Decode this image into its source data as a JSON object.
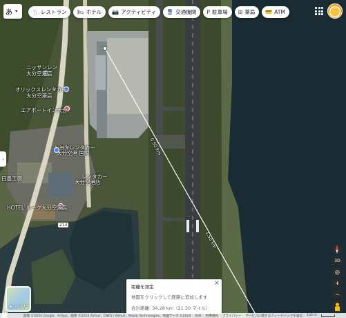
{
  "top_bar": {
    "lang_label": "あ",
    "chips": [
      {
        "icon": "fork-knife-icon",
        "glyph": "🍴",
        "label": "レストラン"
      },
      {
        "icon": "bed-icon",
        "glyph": "🛏",
        "label": "ホテル"
      },
      {
        "icon": "camera-icon",
        "glyph": "📷",
        "label": "アクティビティ"
      },
      {
        "icon": "train-icon",
        "glyph": "🚆",
        "label": "交通機関"
      },
      {
        "icon": "parking-icon",
        "glyph": "P",
        "label": "駐車場"
      },
      {
        "icon": "pharmacy-icon",
        "glyph": "⊞",
        "label": "薬局"
      },
      {
        "icon": "atm-icon",
        "glyph": "💳",
        "label": "ATM"
      }
    ]
  },
  "map_labels": {
    "nissan": "ニッサンレン",
    "nissan_sub": "大分空港店",
    "orix": "オリックスレンタカー",
    "orix_sub": "大分空港店",
    "airport_inn": "エアポートイン大分",
    "toyota": "トヨタレンタカー",
    "toyota_sub": "大分空港 国際",
    "rentacar_small": "レンタカー",
    "rentacar_small_sub": "大分空港店",
    "hotel_left": "日豊工宿",
    "hotel_big": "HOTEL ルーク大分空港店",
    "route_badge": "213",
    "distance_mid": "0.50 km",
    "distance_low": "1.50 km"
  },
  "measure": {
    "title": "距離を測定",
    "hint": "地図をクリックして経路に追加します",
    "total": "合計距離: 34.28 km（21.30 マイル）"
  },
  "layers": {
    "label": "レイヤ"
  },
  "controls": {
    "view_3d": "3D",
    "zoom_in": "+",
    "zoom_out": "−"
  },
  "attribution": {
    "text": "画像 ©2024 Google、Airbus、画像 ©2024 Airbus、CNES / Airbus、Maxar Technologies、地図データ ©2024",
    "japan": "日本",
    "terms": "利用規約",
    "privacy": "プライバシー",
    "feedback": "サービスに関するフィードバックを送信",
    "scale": "100 m"
  },
  "colors": {
    "sea": "#1b2b34",
    "land": "#4e5b3a",
    "runway": "#3a3d3f",
    "measure_line": "#ffffff"
  }
}
